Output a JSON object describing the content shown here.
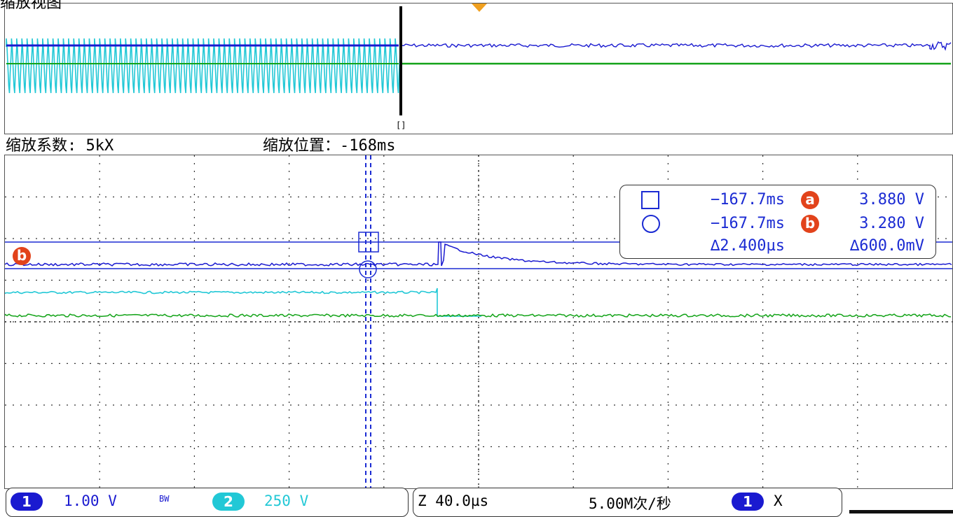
{
  "overview": {
    "title_fragment": "缩放视图"
  },
  "zoom_info": {
    "factor_label": "缩放系数:",
    "factor_value": "5kX",
    "position_label": "缩放位置：",
    "position_value": "-168ms"
  },
  "cursor_readout": {
    "cursor_a": {
      "time": "−167.7ms",
      "badge": "a",
      "value": "3.880 V"
    },
    "cursor_b": {
      "time": "−167.7ms",
      "badge": "b",
      "value": "3.280 V"
    },
    "delta_time": "∆2.400µs",
    "delta_value": "∆600.0mV"
  },
  "marker_b": "b",
  "status": {
    "ch1": {
      "badge": "1",
      "scale": "1.00 V",
      "bw": "BW"
    },
    "ch2": {
      "badge": "2",
      "scale": "250 V"
    },
    "timebase": "Z 40.0µs",
    "sample_rate": "5.00M次/秒",
    "trigger": {
      "badge": "1",
      "mode": "X"
    }
  },
  "colors": {
    "ch1": "#1a1ad0",
    "ch2": "#22c8d6",
    "ch3": "#13a318",
    "cursor": "#1b2bd3",
    "badge_orange": "#e2431b",
    "trigger_orange": "#f0a020",
    "grid": "#333333"
  }
}
